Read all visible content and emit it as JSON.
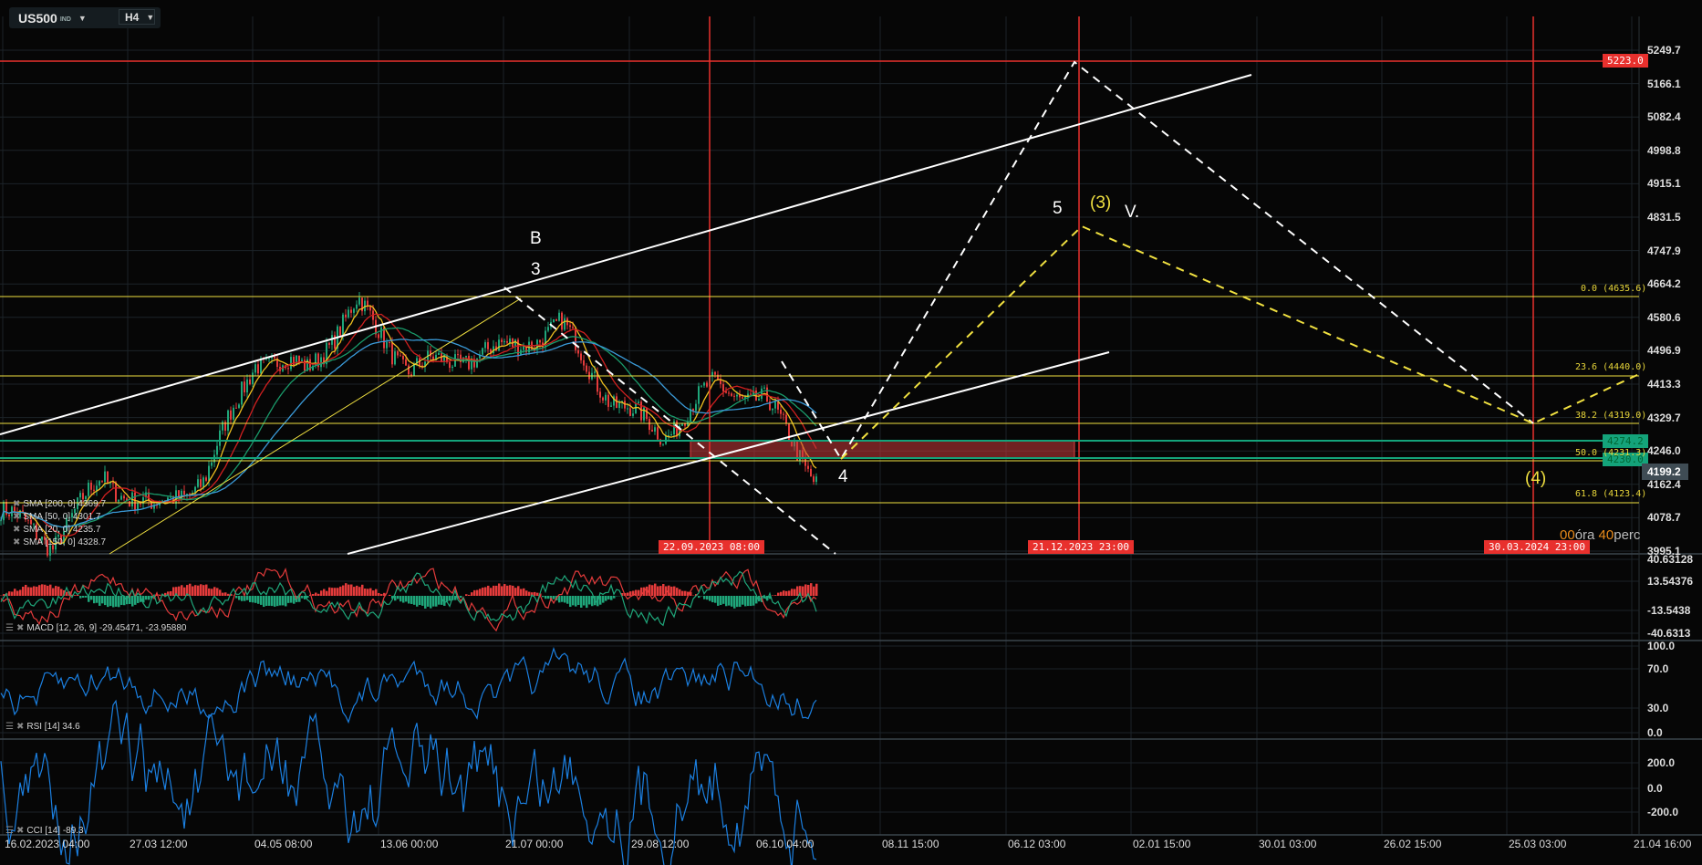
{
  "header": {
    "symbol": "US500",
    "symbol_type": "IND",
    "timeframe": "H4"
  },
  "colors": {
    "up": "#1fa67a",
    "down": "#e43b3b",
    "fib": "#f0e040",
    "red_line": "#e8302d",
    "green_tag": "#14a37a",
    "rsi": "#1b7fe0"
  },
  "price_axis": [
    "5249.7",
    "5166.1",
    "5082.4",
    "4998.8",
    "4915.1",
    "4831.5",
    "4747.9",
    "4664.2",
    "4580.6",
    "4496.9",
    "4413.3",
    "4329.7",
    "4246.0",
    "4162.4",
    "4078.7",
    "3995.1"
  ],
  "current_price": "4199.2",
  "horizontal_level": "5223.0",
  "green_levels": [
    "4274.2",
    "4230.0"
  ],
  "fib_levels": [
    "0.0 (4635.6)",
    "23.6 (4440.0)",
    "38.2 (4319.0)",
    "50.0 (4231.3)",
    "61.8 (4123.4)"
  ],
  "vertical_markers": [
    "22.09.2023 08:00",
    "21.12.2023 23:00",
    "30.03.2024 23:00"
  ],
  "wave_labels": {
    "b": "B",
    "three": "3",
    "five": "5",
    "three_paren": "(3)",
    "v": "V.",
    "four": "4",
    "four_paren": "(4)"
  },
  "countdown": {
    "hours": "00",
    "hours_unit": "óra",
    "minutes": "40",
    "minutes_unit": "perc"
  },
  "sma_legend": [
    "SMA [200, 0] 4369.7",
    "SMA [50, 0] 4301.7",
    "SMA [20, 0] 4235.7",
    "SMA [150, 0] 4328.7"
  ],
  "macd": {
    "label": "MACD [12, 26, 9] -29.45471,  -23.95880",
    "axis": [
      "40.63128",
      "13.54376",
      "-13.5438",
      "-40.6313"
    ]
  },
  "rsi": {
    "label": "RSI [14] 34.6",
    "axis": [
      "100.0",
      "70.0",
      "30.0",
      "0.0"
    ]
  },
  "cci": {
    "label": "CCI [14] -89.3",
    "axis": [
      "200.0",
      "0.0",
      "-200.0"
    ]
  },
  "time_axis": [
    "16.02.2023  04:00",
    "27.03  12:00",
    "04.05  08:00",
    "13.06  00:00",
    "21.07  00:00",
    "29.08  12:00",
    "06.10  04:00",
    "08.11  15:00",
    "06.12  03:00",
    "02.01  15:00",
    "30.01  03:00",
    "26.02  15:00",
    "25.03  03:00",
    "21.04  16:00"
  ],
  "price_keypoints": [
    4098,
    4016,
    4178,
    4098,
    4178,
    4478,
    4450,
    4615,
    4450,
    4478,
    4505,
    4560,
    4370,
    4288,
    4411,
    4370,
    4178
  ]
}
